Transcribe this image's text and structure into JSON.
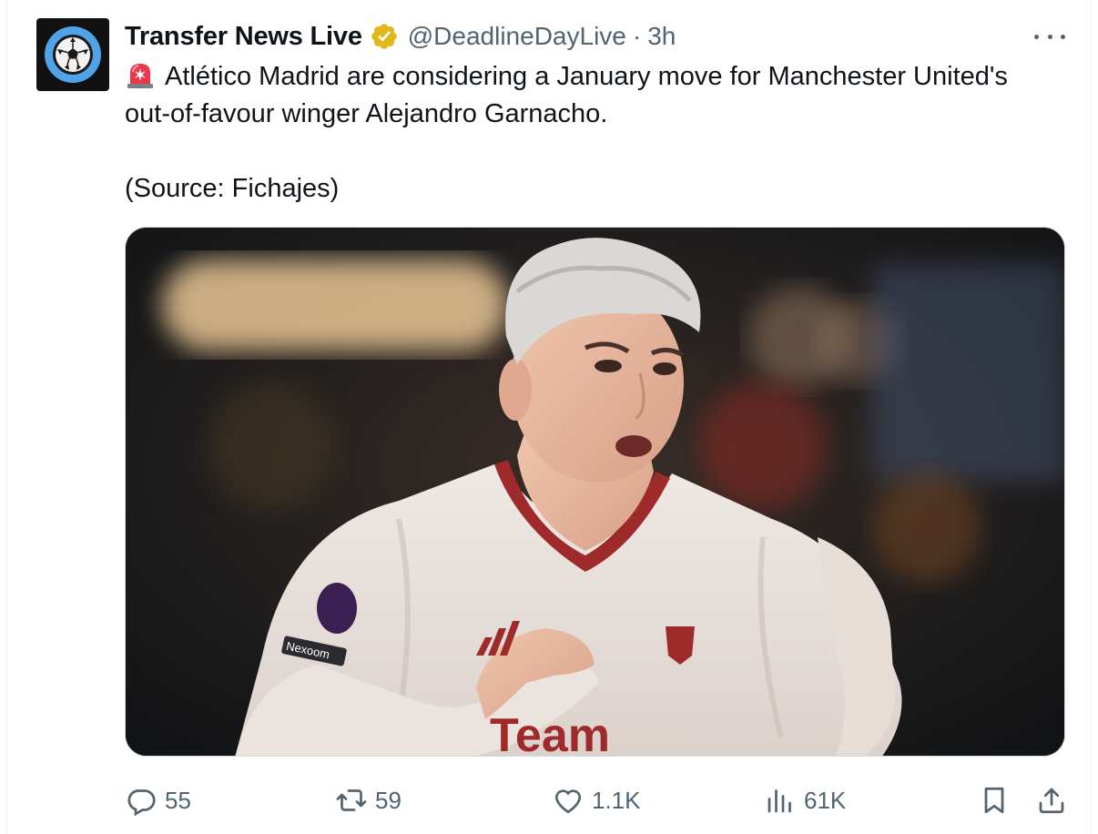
{
  "author": {
    "display_name": "Transfer News Live",
    "handle": "@DeadlineDayLive",
    "separator": "·",
    "time": "3h",
    "avatar_icon": "soccer-ball-icon",
    "verified_icon": "verified-gold-badge-icon"
  },
  "tweet": {
    "emoji_icon": "police-siren-icon",
    "line1": "Atlético Madrid are considering a January move for Manchester United's",
    "line2": "out-of-favour winger Alejandro Garnacho.",
    "line3": "(Source: Fichajes)"
  },
  "media": {
    "kit_sponsor_text": "Team",
    "sleeve_badge_text": "Nexoom"
  },
  "actions": {
    "reply_count": "55",
    "repost_count": "59",
    "like_count": "1.1K",
    "views_count": "61K"
  },
  "colors": {
    "text_primary": "#0f1419",
    "text_secondary": "#536471",
    "border": "#cfd9de",
    "verified_gold": "#e2b719"
  }
}
